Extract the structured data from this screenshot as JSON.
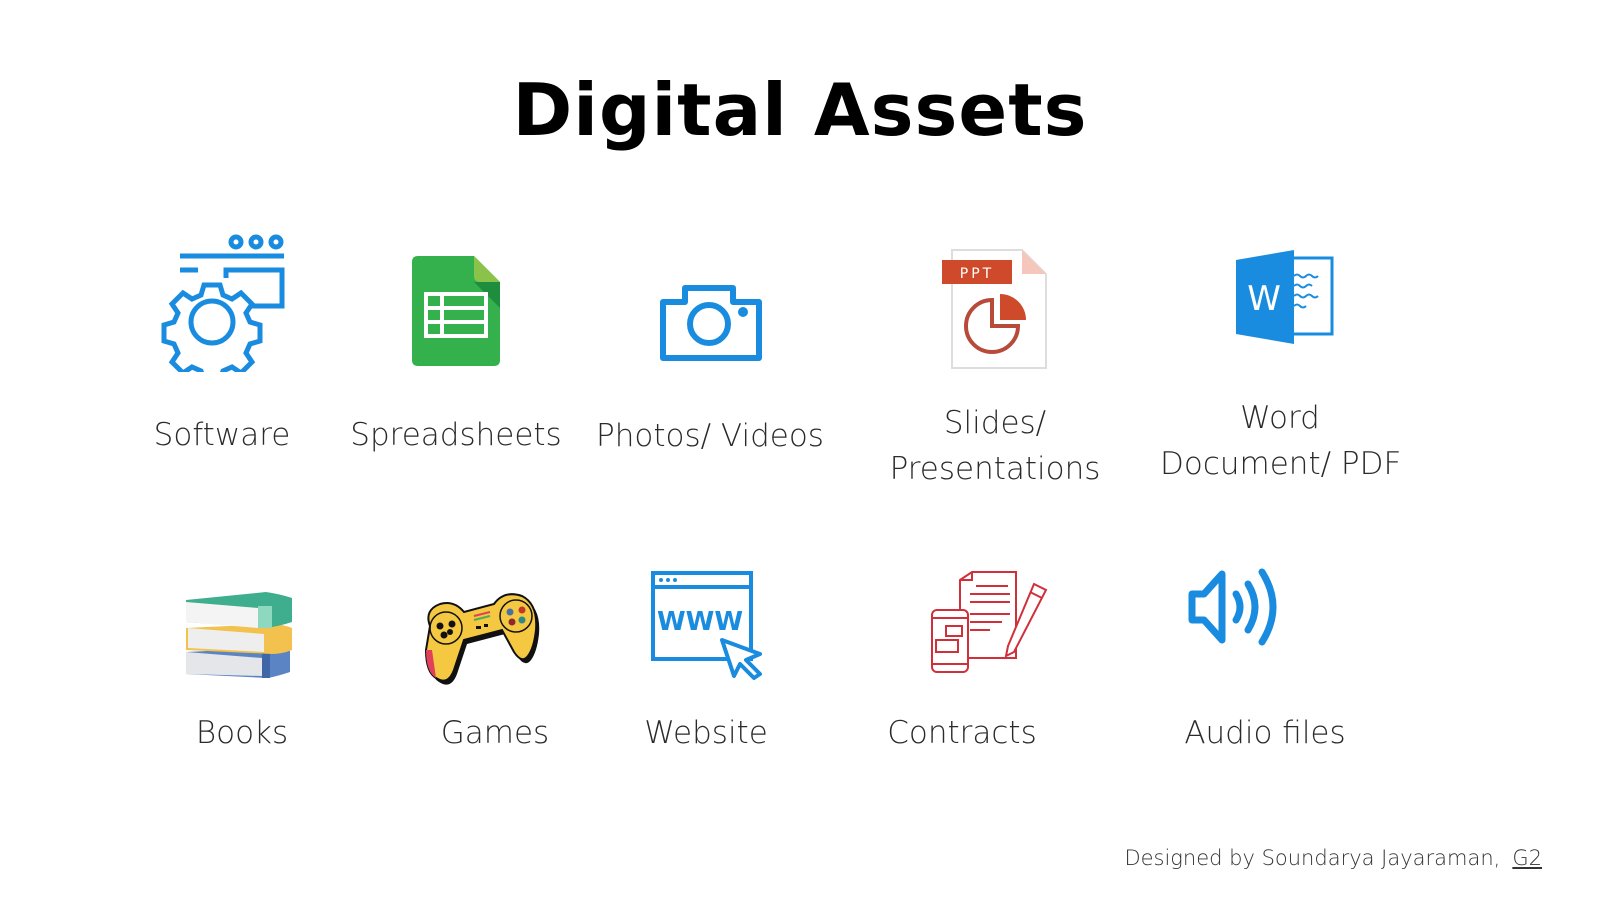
{
  "title": "Digital Assets",
  "assets": [
    {
      "name": "software",
      "label": "Software",
      "icon": "gear-window-icon",
      "color": "#1a8ce0"
    },
    {
      "name": "spreadsheets",
      "label": "Spreadsheets",
      "icon": "spreadsheet-icon",
      "color": "#2fb14a"
    },
    {
      "name": "photos-videos",
      "label": "Photos/ Videos",
      "icon": "camera-icon",
      "color": "#1a8ce0"
    },
    {
      "name": "slides",
      "label_line1": "Slides/",
      "label_line2": "Presentations",
      "icon": "ppt-file-icon",
      "badge": "PPT",
      "color": "#cf4a2a"
    },
    {
      "name": "word",
      "label_line1": "Word",
      "label_line2": "Document/ PDF",
      "icon": "word-icon",
      "badge": "W",
      "color": "#1a8ce0"
    },
    {
      "name": "books",
      "label": "Books",
      "icon": "books-icon"
    },
    {
      "name": "games",
      "label": "Games",
      "icon": "gamepad-icon",
      "color": "#f5c842"
    },
    {
      "name": "website",
      "label": "Website",
      "icon": "browser-www-icon",
      "badge": "WWW",
      "color": "#1a8ce0"
    },
    {
      "name": "contracts",
      "label": "Contracts",
      "icon": "contract-icon",
      "color": "#d0303a"
    },
    {
      "name": "audio",
      "label": "Audio files",
      "icon": "speaker-icon",
      "color": "#1a8ce0"
    }
  ],
  "credit": {
    "text": "Designed by Soundarya Jayaraman,",
    "link": "G2"
  }
}
